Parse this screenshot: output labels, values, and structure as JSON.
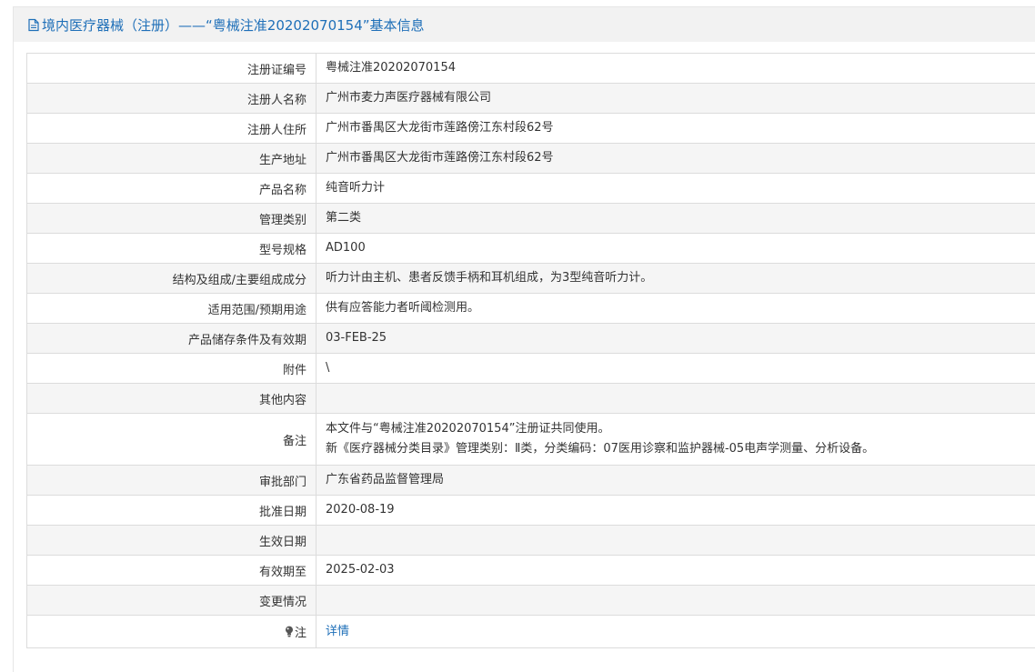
{
  "header": {
    "title": "境内医疗器械（注册）——“粤械注准20202070154”基本信息"
  },
  "rows": [
    {
      "label": "注册证编号",
      "value": "粤械注准20202070154"
    },
    {
      "label": "注册人名称",
      "value": "广州市麦力声医疗器械有限公司"
    },
    {
      "label": "注册人住所",
      "value": "广州市番禺区大龙街市莲路傍江东村段62号"
    },
    {
      "label": "生产地址",
      "value": "广州市番禺区大龙街市莲路傍江东村段62号"
    },
    {
      "label": "产品名称",
      "value": "纯音听力计"
    },
    {
      "label": "管理类别",
      "value": "第二类"
    },
    {
      "label": "型号规格",
      "value": "AD100"
    },
    {
      "label": "结构及组成/主要组成成分",
      "value": "听力计由主机、患者反馈手柄和耳机组成，为3型纯音听力计。"
    },
    {
      "label": "适用范围/预期用途",
      "value": "供有应答能力者听阈检测用。"
    },
    {
      "label": "产品储存条件及有效期",
      "value": "03-FEB-25"
    },
    {
      "label": "附件",
      "value": "\\"
    },
    {
      "label": "其他内容",
      "value": ""
    }
  ],
  "remark": {
    "label": "备注",
    "line1": "本文件与“粤械注准20202070154”注册证共同使用。",
    "line2": "新《医疗器械分类目录》管理类别：Ⅱ类，分类编码：07医用诊察和监护器械-05电声学测量、分析设备。"
  },
  "rows_after": [
    {
      "label": "审批部门",
      "value": "广东省药品监督管理局"
    },
    {
      "label": "批准日期",
      "value": "2020-08-19"
    },
    {
      "label": "生效日期",
      "value": ""
    },
    {
      "label": "有效期至",
      "value": "2025-02-03"
    },
    {
      "label": "变更情况",
      "value": ""
    }
  ],
  "note": {
    "label": "注",
    "link_text": "详情",
    "icon": "lightbulb-icon"
  },
  "colors": {
    "accent": "#1e6fb8",
    "header_bg": "#f2f2f2",
    "row_alt_bg": "#f5f5f5",
    "border": "#dcdcdc"
  }
}
